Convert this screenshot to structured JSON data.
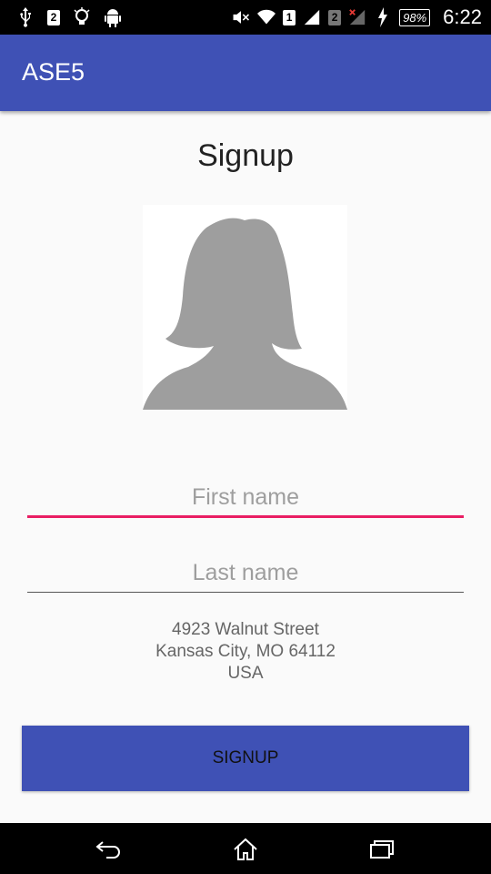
{
  "status_bar": {
    "sim1": "2",
    "sim2_a": "1",
    "sim2_b": "2",
    "battery": "98%",
    "time": "6:22",
    "left_icons": [
      "usb-icon",
      "sim-notification-icon",
      "lightbulb-icon",
      "android-icon"
    ],
    "right_icons": [
      "mute-icon",
      "wifi-icon",
      "signal-1-icon",
      "signal-2-no-service-icon",
      "charging-icon"
    ]
  },
  "app_bar": {
    "title": "ASE5",
    "color": "#3f51b5"
  },
  "page": {
    "title": "Signup"
  },
  "form": {
    "first_name_placeholder": "First name",
    "last_name_placeholder": "Last name",
    "first_name_value": "",
    "last_name_value": "",
    "focus_color": "#e91e63"
  },
  "address": {
    "line1": "4923 Walnut Street",
    "line2": "Kansas City, MO 64112",
    "line3": "USA"
  },
  "button": {
    "label": "SIGNUP",
    "color": "#3f51b5"
  },
  "nav_bar": {
    "icons": [
      "back-icon",
      "home-icon",
      "recents-icon"
    ]
  }
}
